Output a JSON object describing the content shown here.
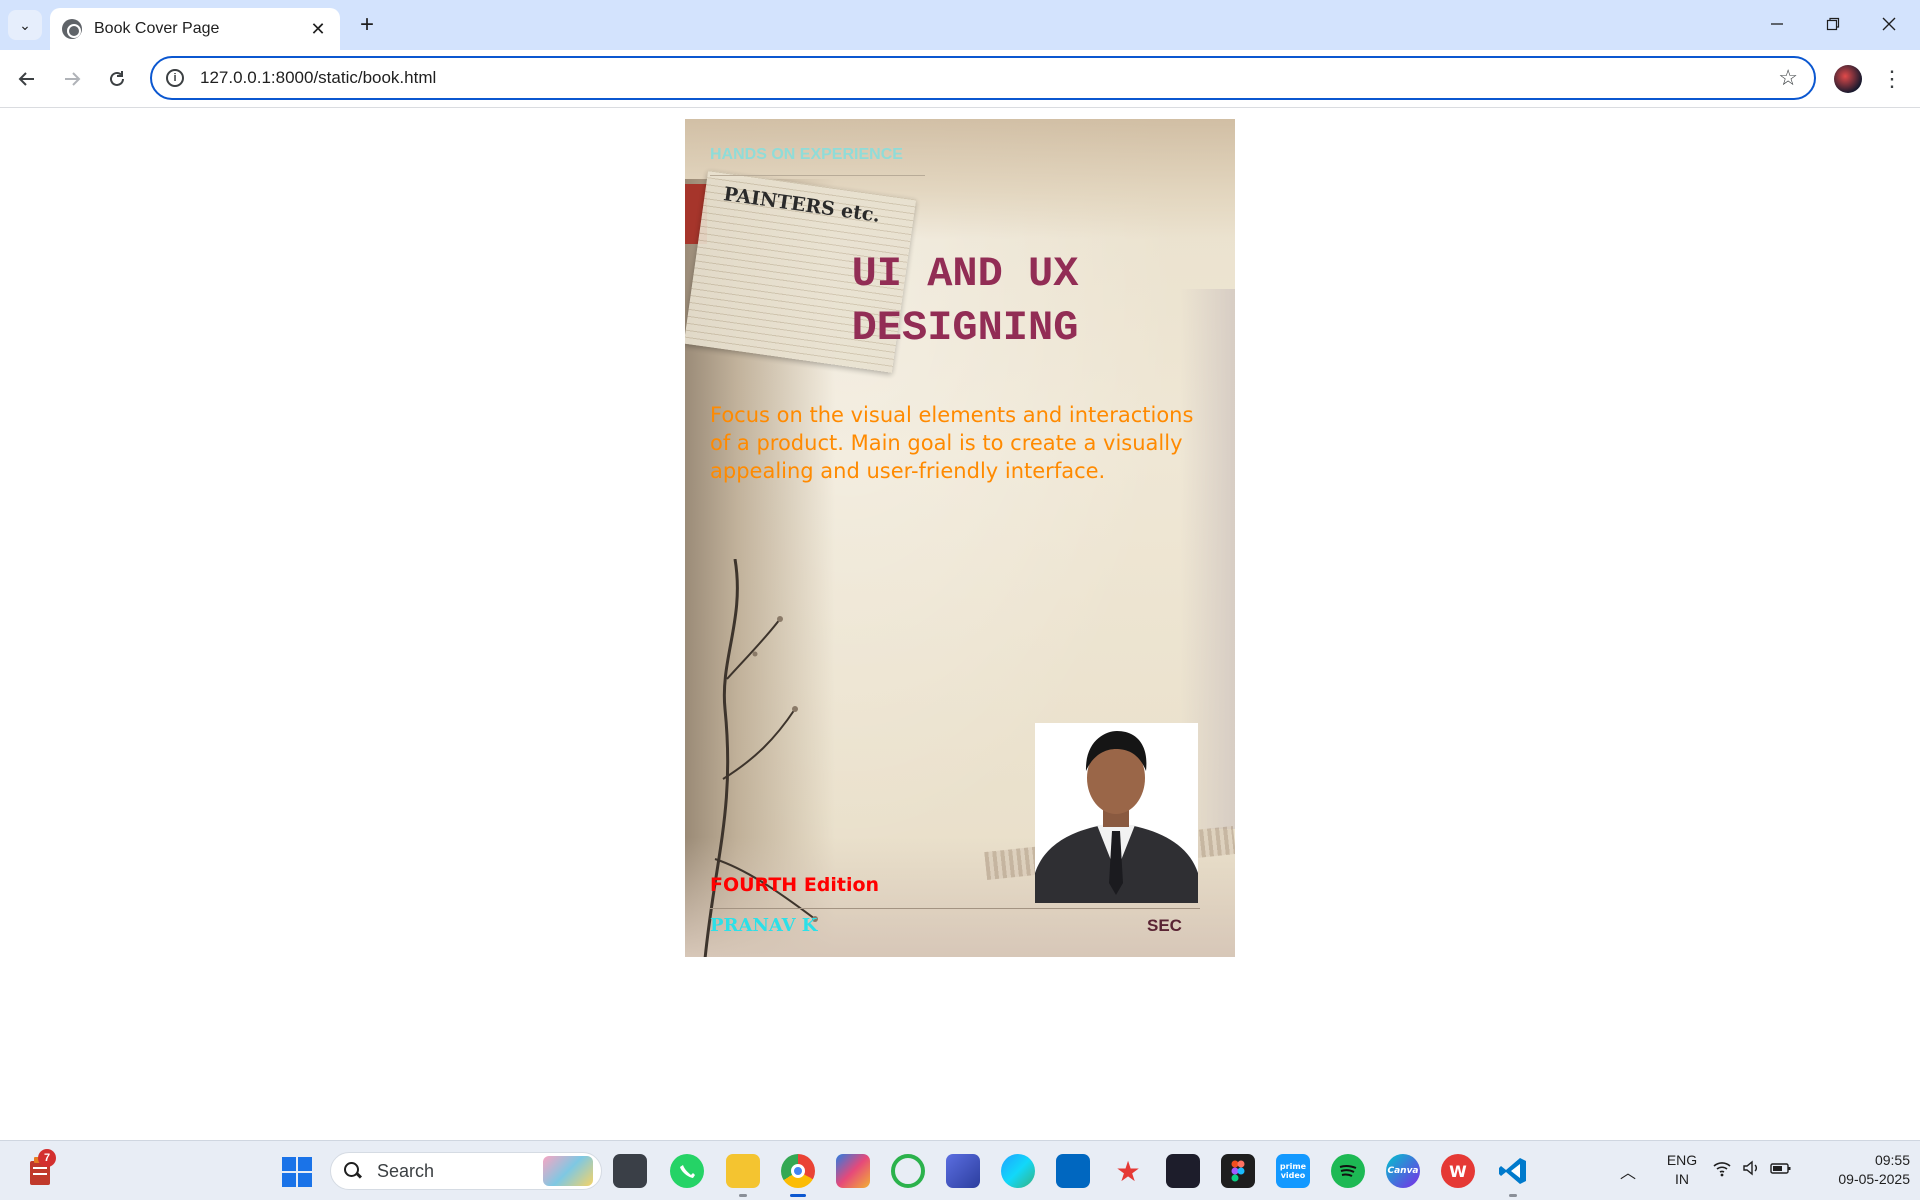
{
  "browser": {
    "tab_title": "Book Cover Page",
    "url": "127.0.0.1:8000/static/book.html",
    "new_tab_label": "+",
    "close_tab_label": "✕"
  },
  "cover": {
    "tag_top": "HANDS ON EXPERIENCE",
    "painters_label": "PAINTERS etc.",
    "title": "UI AND UX DESIGNING",
    "tagline": "Focus on the visual elements and interactions of a product. Main goal is to create a visually appealing and user-friendly interface.",
    "edition": "FOURTH Edition",
    "author": "PRANAV K",
    "institution": "SEC",
    "colors": {
      "title": "#922d55",
      "tagline": "#ff8a00",
      "edition": "#ff0000",
      "author": "#2ce0e8",
      "tag_top": "#8fdcd8"
    }
  },
  "taskbar": {
    "widget_badge": "7",
    "search_placeholder": "Search",
    "apps": [
      {
        "name": "task-view-icon",
        "label": ""
      },
      {
        "name": "whatsapp-icon",
        "label": ""
      },
      {
        "name": "file-explorer-icon",
        "label": ""
      },
      {
        "name": "chrome-icon",
        "label": ""
      },
      {
        "name": "copilot-icon",
        "label": ""
      },
      {
        "name": "ring-app-icon",
        "label": ""
      },
      {
        "name": "affinity-icon",
        "label": ""
      },
      {
        "name": "edge-icon",
        "label": ""
      },
      {
        "name": "store-icon",
        "label": ""
      },
      {
        "name": "star-app-icon",
        "label": ""
      },
      {
        "name": "davinci-icon",
        "label": ""
      },
      {
        "name": "figma-icon",
        "label": ""
      },
      {
        "name": "prime-video-icon",
        "label": "prime video"
      },
      {
        "name": "spotify-icon",
        "label": ""
      },
      {
        "name": "canva-icon",
        "label": "Canva"
      },
      {
        "name": "wps-icon",
        "label": "W"
      },
      {
        "name": "vscode-icon",
        "label": ""
      }
    ],
    "lang_line1": "ENG",
    "lang_line2": "IN",
    "time": "09:55",
    "date": "09-05-2025"
  }
}
